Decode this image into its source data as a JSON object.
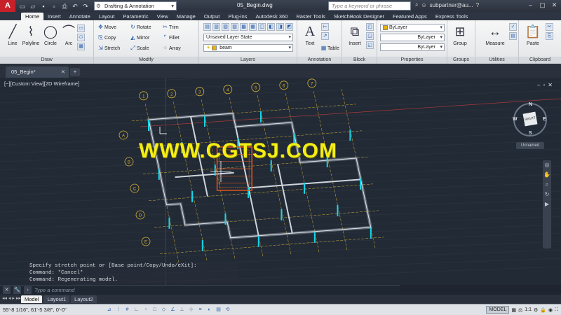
{
  "titlebar": {
    "app_logo": "A",
    "workspace": "Drafting & Annotation",
    "document_title": "05_Begin.dwg",
    "search_placeholder": "Type a keyword or phrase",
    "user": "subpartner@au..."
  },
  "ribbon_tabs": [
    "Home",
    "Insert",
    "Annotate",
    "Layout",
    "Parametric",
    "View",
    "Manage",
    "Output",
    "Plug-ins",
    "Autodesk 360",
    "Raster Tools",
    "SketchBook Designer",
    "Featured Apps",
    "Express Tools"
  ],
  "active_tab": "Home",
  "panels": {
    "draw": {
      "label": "Draw",
      "line": "Line",
      "polyline": "Polyline",
      "circle": "Circle",
      "arc": "Arc"
    },
    "modify": {
      "label": "Modify",
      "move": "Move",
      "rotate": "Rotate",
      "trim": "Trim",
      "copy": "Copy",
      "mirror": "Mirror",
      "fillet": "Fillet",
      "stretch": "Stretch",
      "scale": "Scale",
      "array": "Array"
    },
    "layers": {
      "label": "Layers",
      "layer_state": "Unsaved Layer State",
      "current_layer": "beam"
    },
    "annotation": {
      "label": "Annotation",
      "text": "Text",
      "table": "Table"
    },
    "block": {
      "label": "Block",
      "insert": "Insert"
    },
    "properties": {
      "label": "Properties",
      "color": "ByLayer",
      "linetype": "ByLayer",
      "lineweight": "ByLayer"
    },
    "groups": {
      "label": "Groups",
      "group": "Group"
    },
    "utilities": {
      "label": "Utilities",
      "measure": "Measure"
    },
    "clipboard": {
      "label": "Clipboard",
      "paste": "Paste"
    }
  },
  "doc_tab": {
    "label": "05_Begin*"
  },
  "viewport": {
    "label": "[−][Custom View][2D Wireframe]",
    "ucs_label": "Unnamed",
    "viewcube": {
      "face": "RIGHT",
      "north": "N",
      "south": "S",
      "west": "W",
      "east": "E"
    }
  },
  "grid_labels": {
    "numbers": [
      "1",
      "2",
      "3",
      "4",
      "5",
      "6",
      "7"
    ],
    "letters": [
      "A",
      "B",
      "C",
      "D",
      "E"
    ]
  },
  "watermark": "WWW.CGTSJ.COM",
  "command_history": [
    "Specify stretch point or [Base point/Copy/Undo/eXit]:",
    "Command: *Cancel*",
    "Command:  Regenerating model."
  ],
  "command_placeholder": "Type a command",
  "layout_tabs": [
    "Model",
    "Layout1",
    "Layout2"
  ],
  "status": {
    "coordinates": "55'-8 1/16\",  61'-5 3/8\", 0'-0\"",
    "model": "MODEL",
    "scale": "1:1"
  },
  "colors": {
    "accent": "#f4ee15",
    "structure": "#19d4e8",
    "grid": "#d6b23a",
    "highlight": "#e8561c"
  }
}
